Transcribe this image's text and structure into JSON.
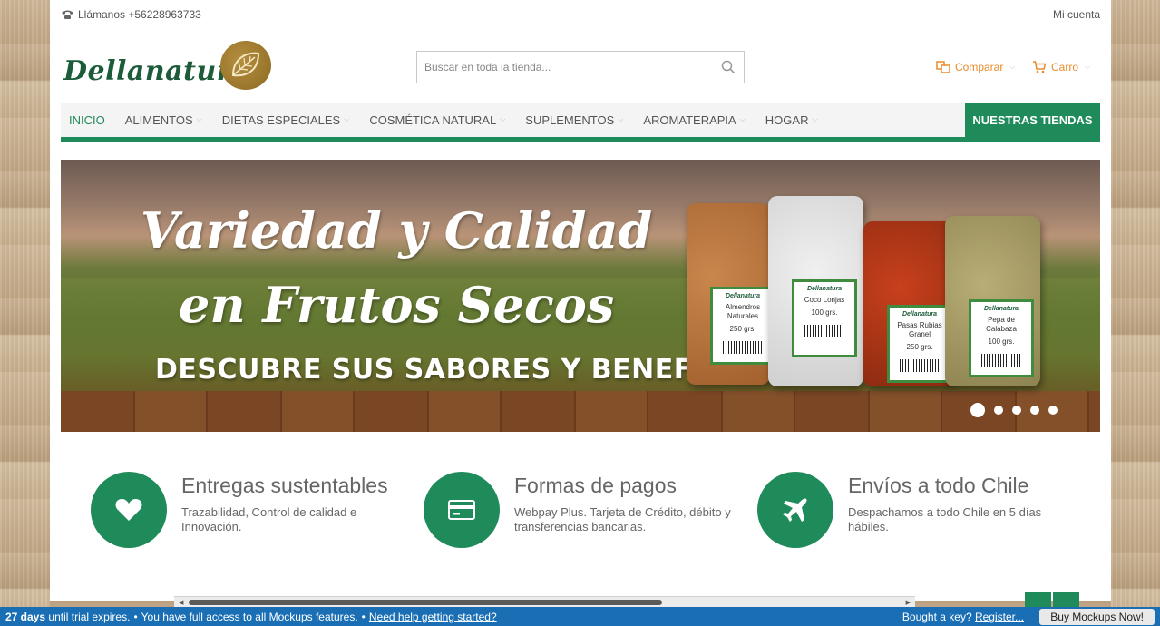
{
  "topbar": {
    "phone_text": "Llámanos +56228963733",
    "account_link": "Mi cuenta"
  },
  "header": {
    "logo_text": "Dellanatura",
    "search_placeholder": "Buscar en toda la tienda...",
    "compare_label": "Comparar",
    "cart_label": "Carro"
  },
  "nav": {
    "items": [
      {
        "label": "INICIO"
      },
      {
        "label": "ALIMENTOS"
      },
      {
        "label": "DIETAS ESPECIALES"
      },
      {
        "label": "COSMÉTICA NATURAL"
      },
      {
        "label": "SUPLEMENTOS"
      },
      {
        "label": "AROMATERAPIA"
      },
      {
        "label": "HOGAR"
      }
    ],
    "stores_label": "NUESTRAS TIENDAS"
  },
  "banner": {
    "title_line1": "Variedad y Calidad",
    "title_line2": "en Frutos Secos",
    "subtitle": "DESCUBRE SUS SABORES Y BENEFICIOS.",
    "products": [
      {
        "brand": "Dellanatura",
        "name": "Almendros Naturales",
        "weight": "250 grs."
      },
      {
        "brand": "Dellanatura",
        "name": "Coco Lonjas",
        "weight": "100 grs."
      },
      {
        "brand": "Dellanatura",
        "name": "Pasas Rubias Granel",
        "weight": "250 grs."
      },
      {
        "brand": "Dellanatura",
        "name": "Pepa de Calabaza",
        "weight": "100 grs."
      }
    ],
    "slide_count": 5,
    "active_slide": 1
  },
  "features": [
    {
      "title": "Entregas sustentables",
      "desc": "Trazabilidad, Control de calidad e Innovación.",
      "icon": "heart-icon"
    },
    {
      "title": "Formas de pagos",
      "desc": "Webpay Plus. Tarjeta de Crédito, débito y transferencias bancarias.",
      "icon": "credit-card-icon"
    },
    {
      "title": "Envíos a todo Chile",
      "desc": "Despachamos a todo Chile en 5 días hábiles.",
      "icon": "airplane-icon"
    }
  ],
  "trial_bar": {
    "days": "27 days",
    "until": "until trial expires.",
    "full_access": "You have full access to all Mockups features.",
    "help_link": "Need help getting started?",
    "bought": "Bought a key?",
    "register_link": "Register...",
    "buy_button": "Buy Mockups Now!"
  },
  "colors": {
    "brand_green": "#1f8a5a",
    "accent_orange": "#e98b2a",
    "trial_blue": "#1a6fb4"
  }
}
